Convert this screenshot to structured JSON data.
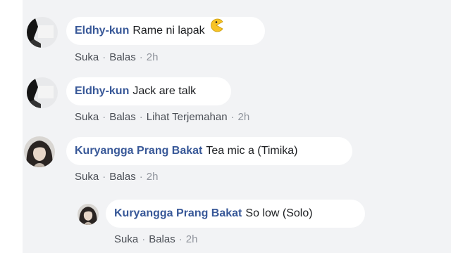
{
  "comments": [
    {
      "author": "Eldhy-kun",
      "text": "Rame ni lapak",
      "emoji": "pacman-icon",
      "actions": {
        "like": "Suka",
        "reply": "Balas",
        "time": "2h"
      }
    },
    {
      "author": "Eldhy-kun",
      "text": "Jack are talk",
      "actions": {
        "like": "Suka",
        "reply": "Balas",
        "translate": "Lihat Terjemahan",
        "time": "2h"
      }
    },
    {
      "author": "Kuryangga Prang Bakat",
      "text": "Tea mic a (Timika)",
      "actions": {
        "like": "Suka",
        "reply": "Balas",
        "time": "2h"
      }
    },
    {
      "author": "Kuryangga Prang Bakat",
      "text": "So low (Solo)",
      "is_reply": true,
      "actions": {
        "like": "Suka",
        "reply": "Balas",
        "time": "2h"
      }
    }
  ],
  "separator": "·",
  "colors": {
    "author": "#385898",
    "panel_bg": "#f2f3f5",
    "bubble_bg": "#ffffff",
    "meta": "#606770",
    "emoji": "#f7c325"
  }
}
